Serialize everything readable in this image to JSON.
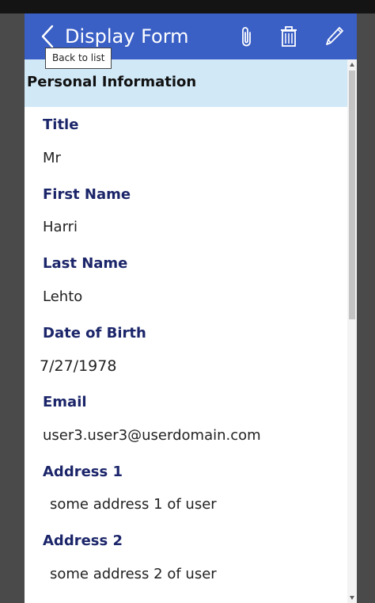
{
  "header": {
    "title": "Display Form",
    "back_tooltip": "Back to list",
    "background_color": "#3a5fc5",
    "icons": [
      "back-chevron-icon",
      "paperclip-icon",
      "trash-icon",
      "pencil-icon"
    ]
  },
  "section": {
    "title": "Personal Information",
    "background_color": "#d1e8f7"
  },
  "fields": [
    {
      "label": "Title",
      "value": "Mr"
    },
    {
      "label": "First Name",
      "value": "Harri"
    },
    {
      "label": "Last Name",
      "value": "Lehto"
    },
    {
      "label": "Date of Birth",
      "value": "7/27/1978"
    },
    {
      "label": "Email",
      "value": "user3.user3@userdomain.com"
    },
    {
      "label": "Address 1",
      "value": "some address 1 of user"
    },
    {
      "label": "Address 2",
      "value": "some address 2 of user"
    }
  ],
  "colors": {
    "label_color": "#1b2569",
    "value_color": "#222222"
  }
}
